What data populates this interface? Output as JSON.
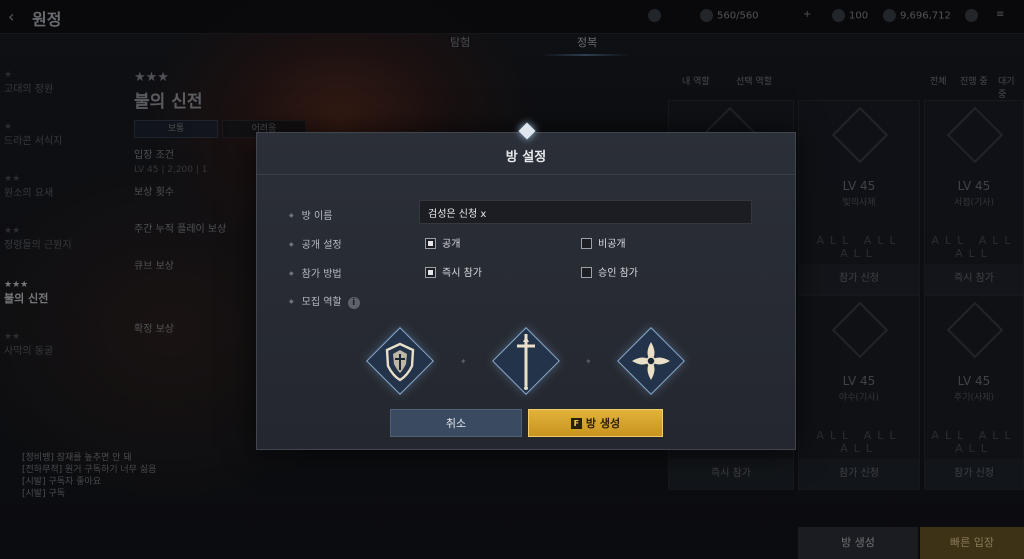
{
  "topbar": {
    "title": "원정",
    "stamina": "560/560",
    "gems": "100",
    "gold": "9,696,712"
  },
  "tabs": [
    "탐험",
    "정복"
  ],
  "left_nav": [
    {
      "stars": "★",
      "label": "고대의 정원"
    },
    {
      "stars": "★",
      "label": "드라콘 서식지"
    },
    {
      "stars": "★★",
      "label": "원소의 요새"
    },
    {
      "stars": "★★",
      "label": "정령들의 근원지"
    },
    {
      "stars": "★★★",
      "label": "불의 신전"
    },
    {
      "stars": "★★",
      "label": "사막의 동굴"
    }
  ],
  "detail": {
    "stars": "★★★",
    "name": "불의 신전",
    "tab1": "보통",
    "tab2": "어려움",
    "sections": [
      "입장 조건",
      "보상 횟수",
      "주간 누적 플레이 보상",
      "큐브 보상",
      "확정 보상"
    ],
    "req": "LV 45  |  2,200  |  1"
  },
  "right": {
    "filter1": "내 역할",
    "filter2": "선택 역할",
    "all": "전체",
    "ongoing": "진행 중",
    "waiting": "대기 중",
    "cards": [
      {
        "lv": "LV 45",
        "cls": "빛의사제",
        "btn": "참가 신청"
      },
      {
        "lv": "LV 45",
        "cls": "서점(기사)",
        "btn": "즉시 참가"
      },
      {
        "lv": "LV 45",
        "cls": "야수(기사)",
        "btn": "참가 신청"
      },
      {
        "lv": "LV 45",
        "cls": "주기(사제)",
        "btn": "참가 신청"
      }
    ],
    "left_btn": "즉시 참가",
    "create": "방 생성",
    "start": "빠른 입장"
  },
  "chat": [
    "[정비뱅] 잠재를 높추면 안 돼",
    "[전하무적] 원거 구독하기 너무 싫음",
    "[시발] 구독자 좋아요",
    "[시발] 구독"
  ],
  "modal": {
    "title": "방 설정",
    "name_label": "방 이름",
    "name_value": "검성은 신청 x",
    "visibility_label": "공개 설정",
    "public": "공개",
    "private": "비공개",
    "join_label": "참가 방법",
    "instant": "즉시 참가",
    "approval": "승인 참가",
    "role_label": "모집 역할",
    "cancel": "취소",
    "create_key": "F",
    "create": "방 생성"
  },
  "colors": {
    "accent_gold": "#d8a52c",
    "cancel_blue": "#3a4a60"
  }
}
